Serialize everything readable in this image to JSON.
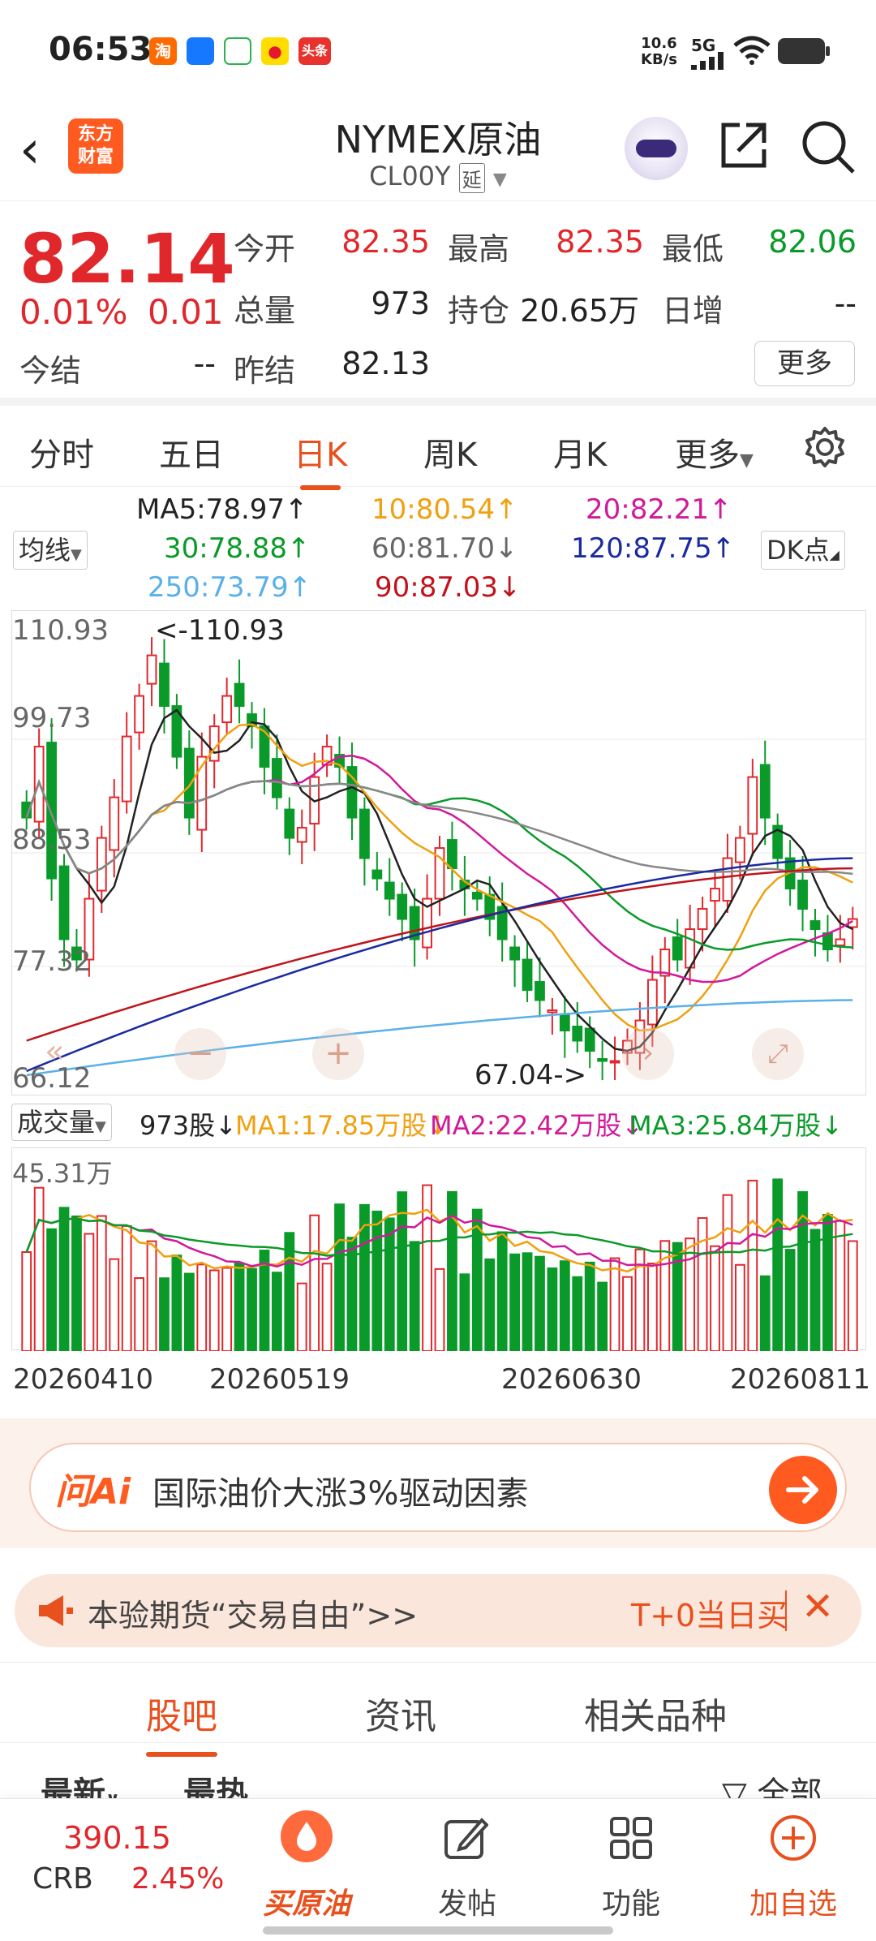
{
  "status_bar": {
    "time": "06:53",
    "app_icons": [
      {
        "label": "淘",
        "color": "#ff6a00"
      },
      {
        "label": "",
        "color": "#1677ff"
      },
      {
        "label": "",
        "color": "#2bb24c"
      },
      {
        "label": "",
        "color": "#e6162d"
      },
      {
        "label": "头条",
        "color": "#e8322e"
      }
    ],
    "speed_value": "10.6",
    "speed_unit": "KB/s",
    "network": "5G"
  },
  "header": {
    "brand_line1": "东方",
    "brand_line2": "财富",
    "title": "NYMEX原油",
    "code": "CL00Y",
    "delay_tag": "延"
  },
  "quote": {
    "price": "82.14",
    "change_pct": "0.01%",
    "change": "0.01",
    "fields": [
      {
        "label": "今开",
        "value": "82.35",
        "color": "red"
      },
      {
        "label": "最高",
        "value": "82.35",
        "color": "red"
      },
      {
        "label": "最低",
        "value": "82.06",
        "color": "green"
      },
      {
        "label": "总量",
        "value": "973",
        "color": "dark"
      },
      {
        "label": "持仓",
        "value": "20.65万",
        "color": "dark"
      },
      {
        "label": "日增",
        "value": "--",
        "color": "dark"
      },
      {
        "label": "今结",
        "value": "--",
        "color": "dark"
      },
      {
        "label": "昨结",
        "value": "82.13",
        "color": "dark"
      }
    ],
    "more_label": "更多"
  },
  "period_tabs": [
    "分时",
    "五日",
    "日K",
    "周K",
    "月K",
    "更多"
  ],
  "active_period": "日K",
  "ma_legend": {
    "selector": "均线",
    "dk_button": "DK点",
    "items": [
      {
        "text": "MA5:78.97↑",
        "color": "#222222"
      },
      {
        "text": "10:80.54↑",
        "color": "#f0a010"
      },
      {
        "text": "20:82.21↑",
        "color": "#d01a9a"
      },
      {
        "text": "30:78.88↑",
        "color": "#0a9a2a"
      },
      {
        "text": "60:81.70↓",
        "color": "#666666"
      },
      {
        "text": "120:87.75↑",
        "color": "#1a2aa0"
      },
      {
        "text": "250:73.79↑",
        "color": "#5ab0e8"
      },
      {
        "text": "90:87.03↓",
        "color": "#c0141c"
      }
    ]
  },
  "chart": {
    "y_ticks": [
      "110.93",
      "99.73",
      "88.53",
      "77.32",
      "66.12"
    ],
    "max_label": "<-110.93",
    "min_label": "67.04->",
    "x_labels": [
      "20260410",
      "20260519",
      "20260630",
      "20260811"
    ]
  },
  "chart_data": {
    "type": "candlestick",
    "ylim": [
      66.12,
      110.93
    ],
    "y_ticks": [
      110.93,
      99.73,
      88.53,
      77.32,
      66.12
    ],
    "x_labels": [
      "20260410",
      "20260519",
      "20260630",
      "20260811"
    ],
    "max_high": 110.93,
    "min_low": 67.04,
    "close_path": [
      92,
      99,
      86,
      80,
      78,
      84,
      90,
      94,
      100,
      104,
      108,
      103,
      98,
      92,
      98,
      101,
      104,
      103,
      101,
      97,
      94,
      90,
      91,
      96,
      99,
      97,
      92,
      88,
      86,
      84,
      82,
      80,
      84,
      89,
      87,
      85,
      84,
      82,
      80,
      78,
      75,
      74,
      73,
      71,
      70,
      69,
      68,
      68,
      70,
      72,
      76,
      79,
      78,
      81,
      83,
      85,
      88,
      90,
      96,
      92,
      88,
      85,
      83,
      81,
      79,
      80,
      82
    ]
  },
  "volume": {
    "selector": "成交量",
    "current": "973股↓",
    "ma1": "MA1:17.85万股↓",
    "ma2": "MA2:22.42万股↓",
    "ma3": "MA3:25.84万股↓",
    "max_label": "45.31万"
  },
  "ai_bar": {
    "logo": "问Ai",
    "text": "国际油价大涨3%驱动因素"
  },
  "promo": {
    "text": "本验期货“交易自由”>>",
    "right_text": "T+0当日买"
  },
  "content_tabs": [
    "股吧",
    "资讯",
    "相关品种"
  ],
  "active_content_tab": "股吧",
  "sub_tabs": [
    "最新",
    "最热"
  ],
  "all_label": "全部",
  "bottom_nav": {
    "index_value": "390.15",
    "index_name": "CRB",
    "index_pct": "2.45%",
    "buy_label": "买原油",
    "post_label": "发帖",
    "func_label": "功能",
    "watch_label": "加自选"
  },
  "colors": {
    "accent": "#e8501e",
    "up": "#e0282c",
    "down": "#0a9a2a"
  }
}
